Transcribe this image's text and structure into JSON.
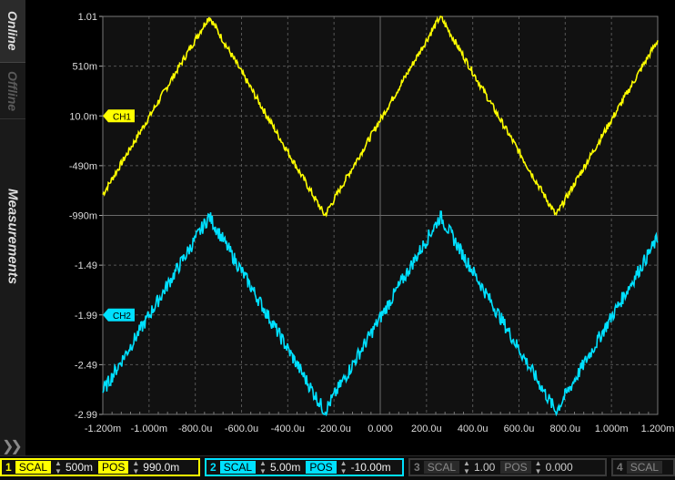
{
  "sidebar": {
    "tabs": [
      {
        "label": "Online"
      },
      {
        "label": "Offline"
      },
      {
        "label": "Measurements"
      }
    ]
  },
  "colors": {
    "ch1": "#ffff00",
    "ch2": "#00e0ff",
    "grid": "#555555",
    "background": "#111111"
  },
  "chart_data": {
    "type": "line",
    "x_tick_labels": [
      "-1.200m",
      "-1.000m",
      "-800.0u",
      "-600.0u",
      "-400.0u",
      "-200.0u",
      "0.000",
      "200.0u",
      "400.0u",
      "600.0u",
      "800.0u",
      "1.000m",
      "1.200m"
    ],
    "y_tick_labels": [
      "1.01",
      "510m",
      "10.0m",
      "-490m",
      "-990m",
      "-1.49",
      "-1.99",
      "-2.49",
      "-2.99"
    ],
    "xlim": [
      -1.2,
      1.2
    ],
    "ylim": [
      -2.99,
      1.01
    ],
    "grid": true,
    "series": [
      {
        "name": "CH1",
        "x": [
          -1.2,
          -0.74,
          -0.24,
          0.26,
          0.76,
          1.2
        ],
        "y": [
          -0.78,
          1.01,
          -0.99,
          1.01,
          -0.99,
          0.77
        ]
      },
      {
        "name": "CH2",
        "x": [
          -1.2,
          -0.74,
          -0.24,
          0.26,
          0.76,
          1.2
        ],
        "y": [
          -2.76,
          -1.0,
          -2.96,
          -1.0,
          -2.96,
          -1.22
        ]
      }
    ],
    "markers": [
      {
        "label": "CH1",
        "y": 0.01
      },
      {
        "label": "CH2",
        "y": -1.99
      }
    ]
  },
  "footer": {
    "ch1": {
      "num": "1",
      "scal_label": "SCAL",
      "scal": "500m",
      "pos_label": "POS",
      "pos": "990.0m"
    },
    "ch2": {
      "num": "2",
      "scal_label": "SCAL",
      "scal": "5.00m",
      "pos_label": "POS",
      "pos": "-10.00m"
    },
    "ch3": {
      "num": "3",
      "scal_label": "SCAL",
      "scal": "1.00",
      "pos_label": "POS",
      "pos": "0.000"
    },
    "ch4": {
      "num": "4",
      "scal_label": "SCAL"
    }
  }
}
